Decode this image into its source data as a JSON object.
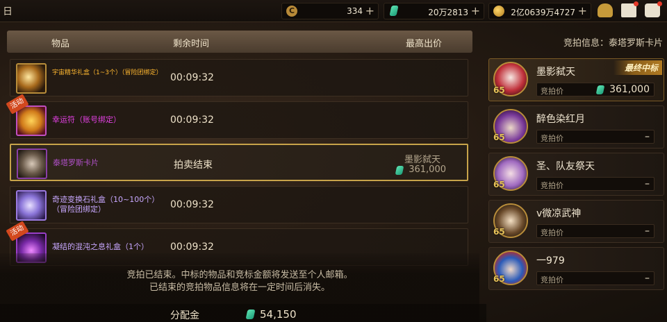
{
  "topbar": {
    "title": "日",
    "currencies": [
      {
        "icon": "coin-c-icon",
        "value": "334"
      },
      {
        "icon": "gem-icon",
        "value": "20万2813"
      },
      {
        "icon": "gold-coin-icon",
        "value": "2亿0639万4727"
      }
    ],
    "plus": "+",
    "coin_glyph": "C"
  },
  "list": {
    "headers": {
      "item": "物品",
      "time": "剩余时间",
      "price": "最高出价"
    },
    "rows": [
      {
        "name": "宇宙精华礼盒（1~3个）（冒险团绑定）",
        "time": "00:09:32",
        "event": false
      },
      {
        "name": "幸运符（账号绑定）",
        "time": "00:09:32",
        "event": true
      },
      {
        "name": "泰塔罗斯卡片",
        "time": "拍卖结束",
        "bidder": "墨影弑天",
        "price": "361,000",
        "selected": true
      },
      {
        "name": "奇迹变换石礼盒（10~100个）（冒险团绑定）",
        "time": "00:09:32",
        "event": false
      },
      {
        "name": "凝结的混沌之息礼盒（1个）",
        "time": "00:09:32",
        "event": true
      }
    ],
    "event_badge": "活动"
  },
  "notice": {
    "line1": "竞拍已结束。中标的物品和竞标金额将发送至个人邮箱。",
    "line2": "已结束的竞拍物品信息将在一定时间后消失。"
  },
  "distribution": {
    "label": "分配金",
    "value": "54,150"
  },
  "side": {
    "info": "竞拍信息：泰塔罗斯卡片",
    "bid_label": "竞拍价",
    "winner_badge": "最终中标",
    "bidders": [
      {
        "name": "墨影弑天",
        "level": "65",
        "bid": "361,000",
        "winner": true
      },
      {
        "name": "醉色染红月",
        "level": "65",
        "bid": "–"
      },
      {
        "name": "圣、队友祭天",
        "level": "65",
        "bid": "–"
      },
      {
        "name": "v微凉武神",
        "level": "65",
        "bid": "–"
      },
      {
        "name": "一979",
        "level": "65",
        "bid": "–"
      }
    ]
  }
}
